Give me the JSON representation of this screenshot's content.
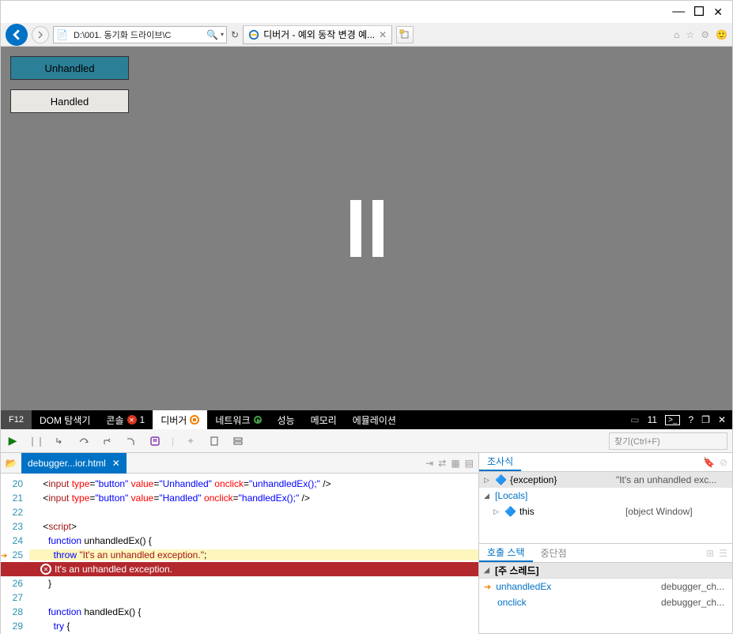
{
  "window": {
    "min": "—",
    "max": "☐",
    "close": "✕"
  },
  "ie": {
    "address": "D:\\001. 동기화 드라이브\\C",
    "tab_title": "디버거 - 예외 동작 변경 예...",
    "right_icons": [
      "home",
      "star",
      "gear",
      "smile"
    ]
  },
  "page": {
    "btn_unhandled": "Unhandled",
    "btn_handled": "Handled"
  },
  "f12": {
    "f12": "F12",
    "tabs": {
      "dom": "DOM 탐색기",
      "console": "콘솔",
      "debugger": "디버거",
      "network": "네트워크",
      "perf": "성능",
      "memory": "메모리",
      "emulation": "에뮬레이션"
    },
    "console_count": "1",
    "right_count": "11"
  },
  "dbg": {
    "search_placeholder": "찾기(Ctrl+F)",
    "file_tab": "debugger...ior.html"
  },
  "code": {
    "l20n": "20",
    "l20": "    <input type=\"button\" value=\"Unhandled\" onclick=\"unhandledEx();\" />",
    "l21n": "21",
    "l21": "    <input type=\"button\" value=\"Handled\" onclick=\"handledEx();\" />",
    "l22n": "22",
    "l22": "",
    "l23n": "23",
    "l23": "    <script>",
    "l24n": "24",
    "l24": "      function unhandledEx() {",
    "l25n": "25",
    "l25": "        throw \"It's an unhandled exception.\";",
    "err": "It's an unhandled exception.",
    "l26n": "26",
    "l26": "      }",
    "l27n": "27",
    "l27": "",
    "l28n": "28",
    "l28": "      function handledEx() {",
    "l29n": "29",
    "l29": "        try {"
  },
  "watch": {
    "tab_watch": "조사식",
    "exc_label": "{exception}",
    "exc_value": "\"It's an unhandled exc...",
    "locals": "[Locals]",
    "this_label": "this",
    "this_value": "[object Window]",
    "tab_callstack": "호출 스택",
    "tab_breakpoints": "중단점",
    "thread": "[주 스레드]",
    "frames": [
      {
        "name": "unhandledEx",
        "loc": "debugger_ch..."
      },
      {
        "name": "onclick",
        "loc": "debugger_ch..."
      }
    ]
  }
}
